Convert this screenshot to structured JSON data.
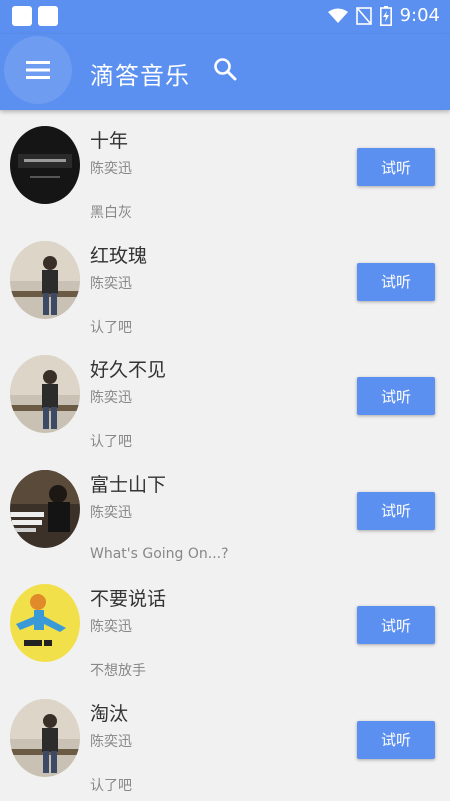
{
  "status": {
    "time": "9:04"
  },
  "header": {
    "title": "滴答音乐"
  },
  "songs": [
    {
      "title": "十年",
      "artist": "陈奕迅",
      "album": "黑白灰",
      "button": "试听",
      "cover": "dark-logo-cover"
    },
    {
      "title": "红玫瑰",
      "artist": "陈奕迅",
      "album": "认了吧",
      "button": "试听",
      "cover": "artist-sitting-cover"
    },
    {
      "title": "好久不见",
      "artist": "陈奕迅",
      "album": "认了吧",
      "button": "试听",
      "cover": "artist-sitting-cover"
    },
    {
      "title": "富士山下",
      "artist": "陈奕迅",
      "album": "What's Going On...?",
      "button": "试听",
      "cover": "whats-going-on-cover"
    },
    {
      "title": "不要说话",
      "artist": "陈奕迅",
      "album": "不想放手",
      "button": "试听",
      "cover": "yellow-cartoon-cover"
    },
    {
      "title": "淘汰",
      "artist": "陈奕迅",
      "album": "认了吧",
      "button": "试听",
      "cover": "artist-sitting-cover"
    }
  ],
  "colors": {
    "primary": "#5b8ff0",
    "background": "#f1f1f1",
    "title_text": "#333333",
    "secondary_text": "#888888"
  }
}
